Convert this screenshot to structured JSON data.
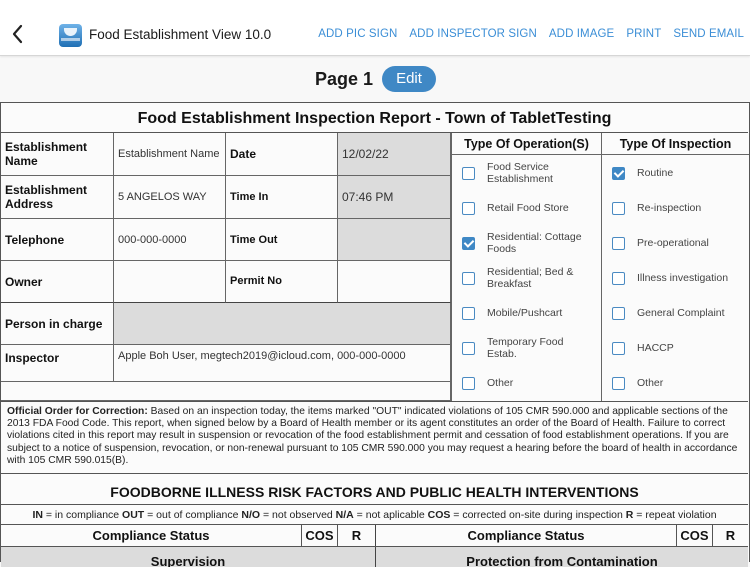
{
  "header": {
    "back_icon": "chevron-left-icon",
    "app_icon": "app-logo-icon",
    "title": "Food Establishment View 10.0",
    "actions": [
      "ADD PIC SIGN",
      "ADD INSPECTOR SIGN",
      "ADD IMAGE",
      "PRINT",
      "SEND EMAIL"
    ]
  },
  "pagebar": {
    "page_label": "Page 1",
    "edit_label": "Edit"
  },
  "report": {
    "title": "Food Establishment Inspection Report - Town of TabletTesting",
    "fields": {
      "establishment_name_label": "Establishment Name",
      "establishment_name_value": "Establishment Name",
      "date_label": "Date",
      "date_value": "12/02/22",
      "address_label": "Establishment Address",
      "address_value": "5 ANGELOS WAY",
      "time_in_label": "Time In",
      "time_in_value": "07:46 PM",
      "telephone_label": "Telephone",
      "telephone_value": "000-000-0000",
      "time_out_label": "Time Out",
      "time_out_value": "",
      "owner_label": "Owner",
      "owner_value": "",
      "permit_label": "Permit No",
      "permit_value": "",
      "person_in_charge_label": "Person in charge",
      "person_in_charge_value": "",
      "inspector_label": "Inspector",
      "inspector_value": "Apple Boh User, megtech2019@icloud.com, 000-000-0000"
    },
    "operation_types": {
      "header": "Type Of Operation(S)",
      "options": [
        {
          "label": "Food Service Establishment",
          "checked": false
        },
        {
          "label": "Retail Food Store",
          "checked": false
        },
        {
          "label": "Residential: Cottage Foods",
          "checked": true
        },
        {
          "label": "Residential; Bed & Breakfast",
          "checked": false
        },
        {
          "label": "Mobile/Pushcart",
          "checked": false
        },
        {
          "label": "Temporary Food Estab.",
          "checked": false
        },
        {
          "label": "Other",
          "checked": false
        }
      ]
    },
    "inspection_types": {
      "header": "Type Of Inspection",
      "options": [
        {
          "label": "Routine",
          "checked": true
        },
        {
          "label": "Re-inspection",
          "checked": false
        },
        {
          "label": "Pre-operational",
          "checked": false
        },
        {
          "label": "Illness investigation",
          "checked": false
        },
        {
          "label": "General Complaint",
          "checked": false
        },
        {
          "label": "HACCP",
          "checked": false
        },
        {
          "label": "Other",
          "checked": false
        }
      ]
    },
    "order": {
      "bold": "Official Order for Correction:",
      "text": " Based on an inspection today, the items marked \"OUT\" indicated violations of 105 CMR 590.000 and applicable sections of the 2013 FDA Food Code. This report, when signed below by a Board of Health member or its agent constitutes an order of the Board of Health. Failure to correct violations cited in this report may result in suspension or revocation of the food establishment permit and cessation of food establishment operations. If you are subject to a notice of suspension, revocation, or non-renewal pursuant to 105 CMR 590.000 you may request a hearing before the board of health in accordance with 105 CMR 590.015(B)."
    },
    "risk_title": "FOODBORNE ILLNESS RISK FACTORS AND PUBLIC HEALTH INTERVENTIONS",
    "legend": [
      {
        "code": "IN",
        "text": " = in compliance "
      },
      {
        "code": "OUT",
        "text": " = out of compliance "
      },
      {
        "code": "N/O",
        "text": " = not observed "
      },
      {
        "code": "N/A",
        "text": " = not aplicable "
      },
      {
        "code": "COS",
        "text": " = corrected on-site during inspection "
      },
      {
        "code": "R",
        "text": " = repeat violation"
      }
    ],
    "compliance_header": {
      "status": "Compliance Status",
      "cos": "COS",
      "r": "R"
    },
    "sections": {
      "left": "Supervision",
      "right": "Protection from Contamination"
    }
  }
}
